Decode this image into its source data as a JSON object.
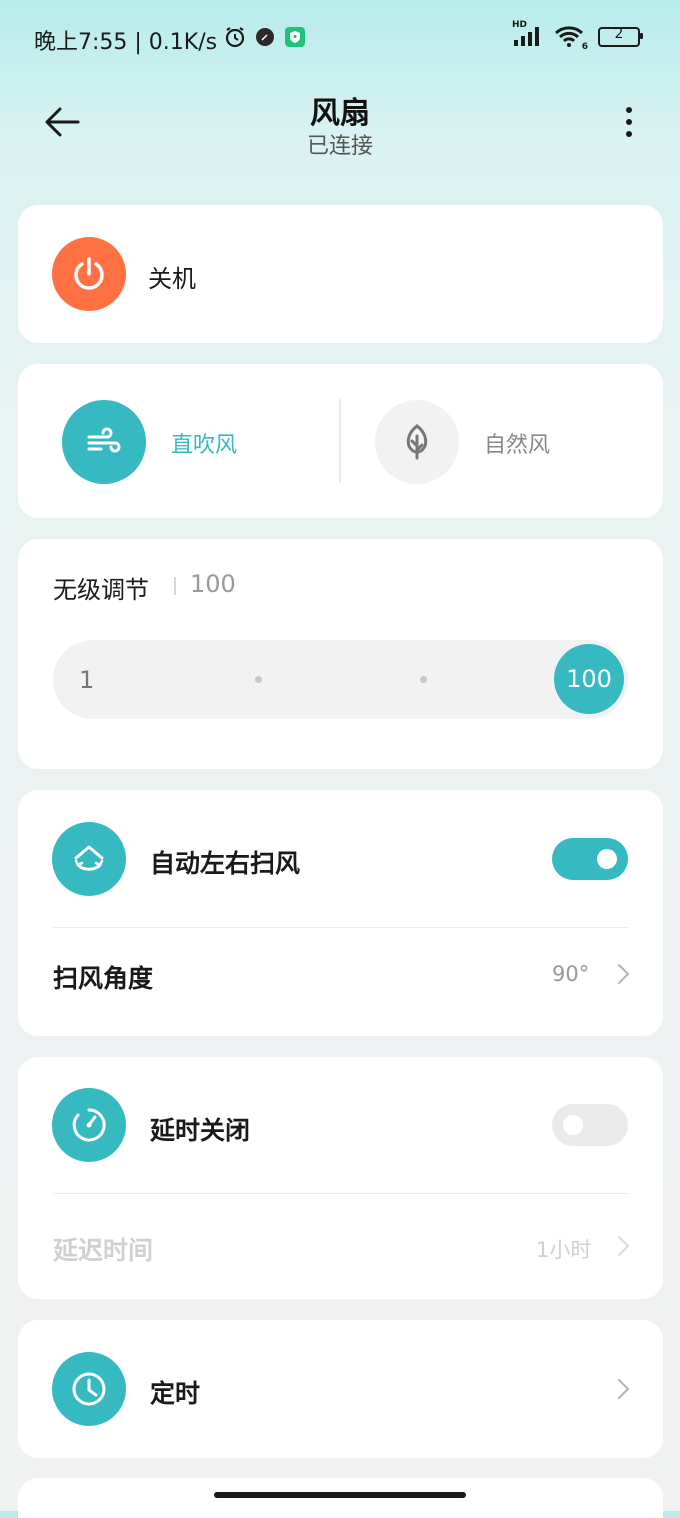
{
  "status_bar": {
    "time_speed": "晚上7:55 | 0.1K/s",
    "battery": "2",
    "network_hd": "HD",
    "wifi_sub": "6"
  },
  "header": {
    "title": "风扇",
    "subtitle": "已连接"
  },
  "power": {
    "label": "关机"
  },
  "modes": {
    "direct": {
      "label": "直吹风",
      "selected": true
    },
    "natural": {
      "label": "自然风",
      "selected": false
    }
  },
  "speed": {
    "label": "无级调节",
    "value": "100",
    "slider_min": "1",
    "slider_value": "100",
    "slider_fraction": 1.0
  },
  "sweep": {
    "label": "自动左右扫风",
    "enabled": true,
    "angle_label": "扫风角度",
    "angle_value": "90°"
  },
  "delay_off": {
    "label": "延时关闭",
    "enabled": false,
    "time_label": "延迟时间",
    "time_value": "1小时"
  },
  "timer": {
    "label": "定时"
  },
  "colors": {
    "accent": "#36b9c1",
    "power": "#ff7042",
    "background_top": "#b8ebec",
    "disabled_text": "#d0d0d0"
  }
}
